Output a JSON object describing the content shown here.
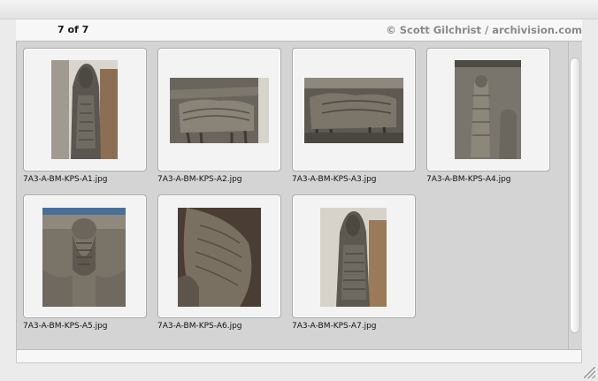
{
  "header": {
    "page_count": "7 of 7",
    "copyright": "© Scott Gilchrist / archivision.com"
  },
  "thumbnails": [
    {
      "filename": "7A3-A-BM-KPS-A1.jpg",
      "subject": "lamassu-front-view"
    },
    {
      "filename": "7A3-A-BM-KPS-A2.jpg",
      "subject": "winged-bull-relief-side"
    },
    {
      "filename": "7A3-A-BM-KPS-A3.jpg",
      "subject": "winged-bull-relief-side"
    },
    {
      "filename": "7A3-A-BM-KPS-A4.jpg",
      "subject": "standing-figure-relief"
    },
    {
      "filename": "7A3-A-BM-KPS-A5.jpg",
      "subject": "bearded-head-closeup"
    },
    {
      "filename": "7A3-A-BM-KPS-A6.jpg",
      "subject": "lamassu-body-detail"
    },
    {
      "filename": "7A3-A-BM-KPS-A7.jpg",
      "subject": "lamassu-front-view"
    }
  ]
}
